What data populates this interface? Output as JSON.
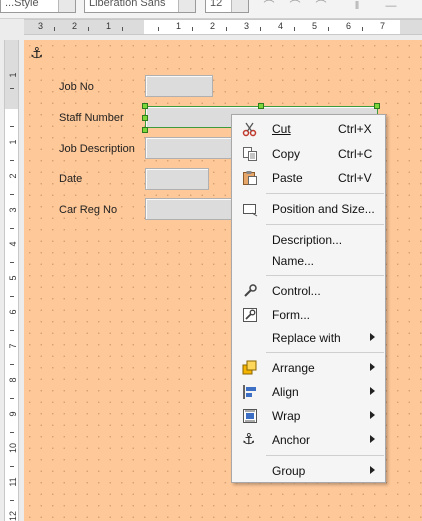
{
  "toolbar": {
    "style_value": "...Style",
    "font_value": "Liberation Sans",
    "size_value": "12"
  },
  "hruler": {
    "numbers": [
      "3",
      "2",
      "1",
      "1",
      "2",
      "3",
      "4",
      "5",
      "6",
      "7"
    ]
  },
  "vruler": {
    "numbers": [
      "1",
      "1",
      "2",
      "3",
      "4",
      "5",
      "6",
      "7",
      "8",
      "9",
      "10",
      "11",
      "12"
    ]
  },
  "form": {
    "labels": [
      "Job No",
      "Staff Number",
      "Job Description",
      "Date",
      "Car Reg No"
    ]
  },
  "context_menu": {
    "items": [
      {
        "label": "Cut",
        "shortcut": "Ctrl+X",
        "icon": "scissors-icon"
      },
      {
        "label": "Copy",
        "shortcut": "Ctrl+C",
        "icon": "copy-icon"
      },
      {
        "label": "Paste",
        "shortcut": "Ctrl+V",
        "icon": "clipboard-icon"
      },
      {
        "label": "Position and Size...",
        "icon": "position-size-icon"
      },
      {
        "label": "Description..."
      },
      {
        "label": "Name..."
      },
      {
        "label": "Control...",
        "icon": "control-properties-icon"
      },
      {
        "label": "Form...",
        "icon": "form-properties-icon"
      },
      {
        "label": "Replace with",
        "submenu": true
      },
      {
        "label": "Arrange",
        "icon": "arrange-icon",
        "submenu": true
      },
      {
        "label": "Align",
        "icon": "align-icon",
        "submenu": true
      },
      {
        "label": "Wrap",
        "icon": "wrap-icon",
        "submenu": true
      },
      {
        "label": "Anchor",
        "icon": "anchor-icon",
        "submenu": true
      },
      {
        "label": "Group",
        "submenu": true
      }
    ]
  },
  "colors": {
    "page_background": "#ffc898",
    "selection_handle": "#7cd83a",
    "menu_background": "#f5f5f5"
  }
}
